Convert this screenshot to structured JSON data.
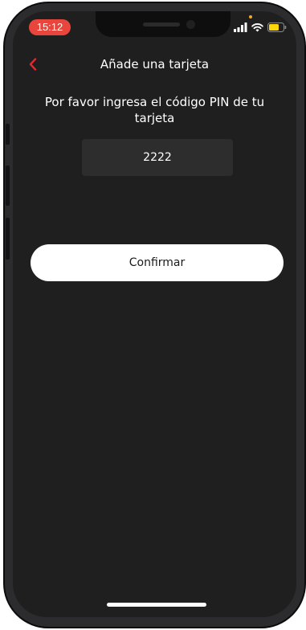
{
  "status_bar": {
    "time": "15:12",
    "icons": [
      "signal-icon",
      "wifi-icon",
      "battery-icon"
    ]
  },
  "nav": {
    "title": "Añade una tarjeta",
    "back_icon": "chevron-left-icon"
  },
  "pin_entry": {
    "prompt": "Por favor ingresa el código PIN de tu tarjeta",
    "value": "2222"
  },
  "actions": {
    "confirm_label": "Confirmar"
  },
  "colors": {
    "background": "#1f1f1f",
    "accent": "#e3262f",
    "time_pill": "#e8453c",
    "field": "#2d2d2d",
    "button": "#ffffff"
  }
}
